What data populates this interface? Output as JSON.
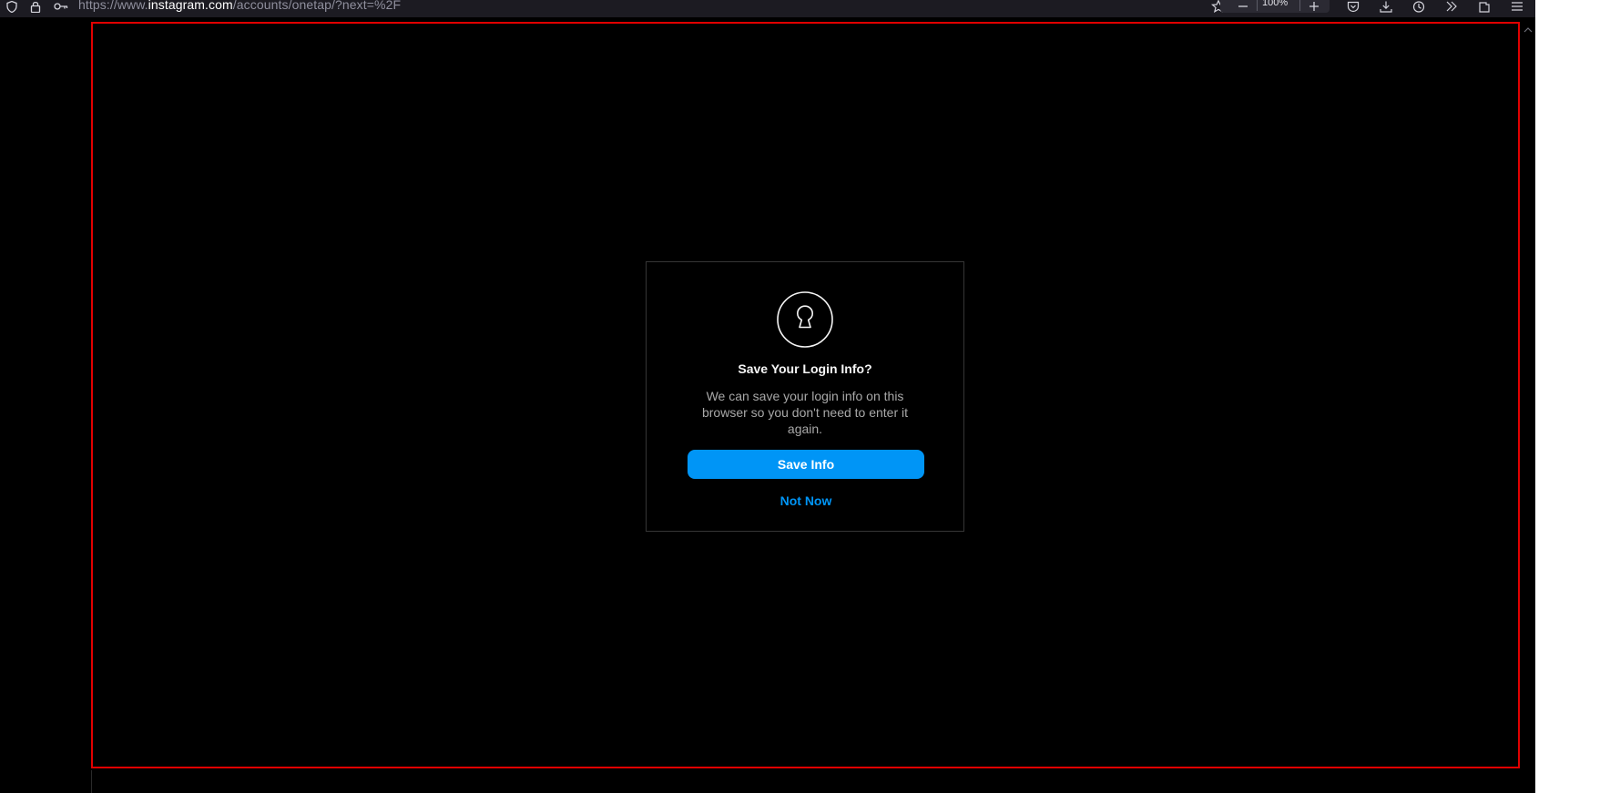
{
  "browser": {
    "url_prefix": "https://www.",
    "url_domain": "instagram.com",
    "url_path": "/accounts/onetap/?next=%2F",
    "zoom_level": "100%",
    "icons": {
      "shield": "shield-icon",
      "lock": "lock-icon",
      "key": "key-icon",
      "bookmark": "star-icon",
      "zoom_out": "minus-icon",
      "zoom_in": "plus-icon",
      "save_to_pocket": "pocket-icon",
      "downloads": "download-icon",
      "history": "history-icon",
      "overflow": "chevron-double-right-icon",
      "extensions": "extensions-icon",
      "menu": "hamburger-menu-icon"
    }
  },
  "dialog": {
    "title": "Save Your Login Info?",
    "body": "We can save your login info on this browser so you don't need to enter it again.",
    "save_label": "Save Info",
    "not_now_label": "Not Now",
    "icon": "keyhole-icon"
  },
  "colors": {
    "page_background": "#000000",
    "primary_button": "#0095f6",
    "link": "#0095f6",
    "dialog_border": "#363636",
    "highlight_frame": "#e10000"
  }
}
